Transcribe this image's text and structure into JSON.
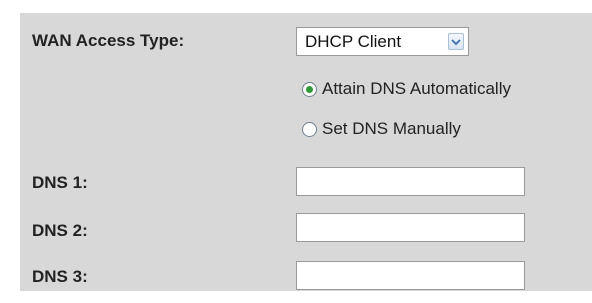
{
  "form": {
    "wan_access_type": {
      "label": "WAN Access Type:",
      "selected": "DHCP Client"
    },
    "dns_mode": {
      "options": [
        {
          "label": "Attain DNS Automatically",
          "checked": true
        },
        {
          "label": "Set DNS Manually",
          "checked": false
        }
      ]
    },
    "dns_fields": [
      {
        "label": "DNS 1:",
        "value": ""
      },
      {
        "label": "DNS 2:",
        "value": ""
      },
      {
        "label": "DNS 3:",
        "value": ""
      }
    ]
  },
  "icons": {
    "dropdown": "chevron-down-icon",
    "radio_checked": "radio-checked-icon",
    "radio_unchecked": "radio-unchecked-icon"
  },
  "colors": {
    "panel_background": "#d8d8d8",
    "radio_selected": "#2f9a37",
    "dropdown_chevron": "#4a78b6"
  }
}
